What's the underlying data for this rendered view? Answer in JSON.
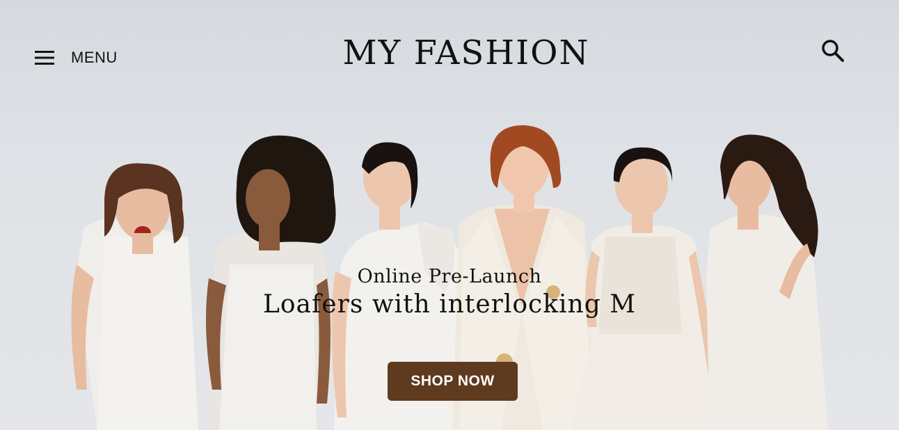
{
  "header": {
    "menu_label": "MENU",
    "menu_icon": "hamburger-icon",
    "logo_text": "MY FASHION",
    "search_icon": "search-icon"
  },
  "hero": {
    "subtitle": "Online Pre-Launch",
    "title": "Loafers with interlocking M",
    "cta_label": "SHOP NOW",
    "cta_color": "#5e3a1f",
    "background_color": "#dcdfe4"
  }
}
